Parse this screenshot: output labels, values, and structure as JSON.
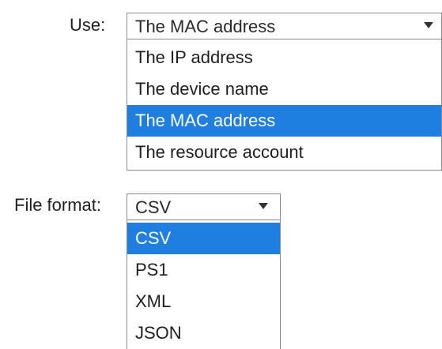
{
  "use": {
    "label": "Use:",
    "selected_value": "The MAC address",
    "options": [
      {
        "label": "The IP address",
        "selected": false
      },
      {
        "label": "The device name",
        "selected": false
      },
      {
        "label": "The MAC address",
        "selected": true
      },
      {
        "label": "The resource account",
        "selected": false
      }
    ],
    "arrow_icon": "chevron-down-icon"
  },
  "file_format": {
    "label": "File format:",
    "selected_value": "CSV",
    "options": [
      {
        "label": "CSV",
        "selected": true
      },
      {
        "label": "PS1",
        "selected": false
      },
      {
        "label": "XML",
        "selected": false
      },
      {
        "label": "JSON",
        "selected": false
      }
    ],
    "arrow_icon": "chevron-down-icon"
  },
  "colors": {
    "selection_highlight": "#1e7fe0",
    "border": "#8a8a8a",
    "text": "#1f1f1f"
  }
}
